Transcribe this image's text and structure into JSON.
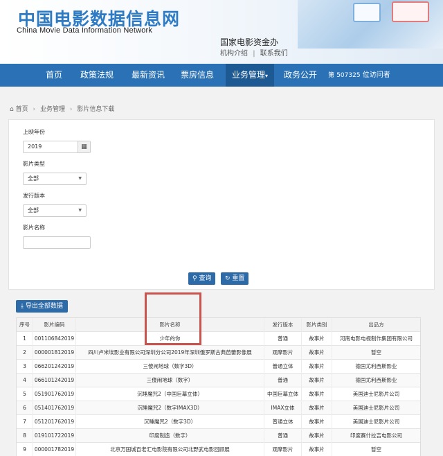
{
  "header": {
    "title": "中国电影数据信息网",
    "subtitle": "China Movie Data Information Network",
    "org_name": "国家电影资金办",
    "org_link_intro": "机构介绍",
    "org_link_sep": "|",
    "org_link_contact": "联系我们"
  },
  "nav": {
    "items": [
      "首页",
      "政策法规",
      "最新资讯",
      "票房信息",
      "业务管理",
      "政务公开"
    ],
    "active_caret": "▾",
    "visitors_count": "507325",
    "visitors_label": "位访问者",
    "visitors_prefix": "第"
  },
  "breadcrumb": [
    "首页",
    "业务管理",
    "影片信息下载"
  ],
  "form": {
    "year_label": "上映年份",
    "year_value": "2019",
    "type_label": "影片类型",
    "type_value": "全部",
    "version_label": "发行版本",
    "version_value": "全部",
    "name_label": "影片名称",
    "name_value": "",
    "search_button": "查询",
    "reset_button": "重置"
  },
  "export_button": "导出全部数据",
  "table": {
    "headers": [
      "序号",
      "影片编码",
      "影片名称",
      "发行版本",
      "影片类别",
      "出品方"
    ],
    "rows": [
      [
        "1",
        "001106842019",
        "少年的你",
        "普通",
        "故事片",
        "河南电影电视制作集团有限公司"
      ],
      [
        "2",
        "000001812019",
        "四川卢米埃影业有限公司深圳分公司2019年深圳俄罗斯古典芭蕾影像展",
        "观摩影片",
        "故事片",
        "暂空"
      ],
      [
        "3",
        "066201242019",
        "三傻闹地球（数字3D）",
        "普通立体",
        "故事片",
        "德国尤利西斯影业"
      ],
      [
        "4",
        "066101242019",
        "三傻闹地球（数字）",
        "普通",
        "故事片",
        "德国尤利西斯影业"
      ],
      [
        "5",
        "051901762019",
        "沉睡魔咒2（中国巨幕立体）",
        "中国巨幕立体",
        "故事片",
        "美国迪士尼影片公司"
      ],
      [
        "6",
        "051401762019",
        "沉睡魔咒2（数字IMAX3D）",
        "IMAX立体",
        "故事片",
        "美国迪士尼影片公司"
      ],
      [
        "7",
        "051201762019",
        "沉睡魔咒2（数字3D）",
        "普通立体",
        "故事片",
        "美国迪士尼影片公司"
      ],
      [
        "8",
        "019101722019",
        "印度制造（数字）",
        "普通",
        "故事片",
        "印度赛什拉吉电影公司"
      ],
      [
        "9",
        "000001782019",
        "北京万国城百老汇电影院有限公司北野武电影回顾展",
        "观摩影片",
        "故事片",
        "暂空"
      ]
    ]
  },
  "colors": {
    "accent": "#2a72b5",
    "title_blue": "#2e7bc4",
    "highlight_red": "#c9534f"
  },
  "icons": {
    "home": "home-icon",
    "calendar": "calendar-icon",
    "search": "search-icon",
    "reset": "refresh-icon",
    "download": "download-icon"
  }
}
